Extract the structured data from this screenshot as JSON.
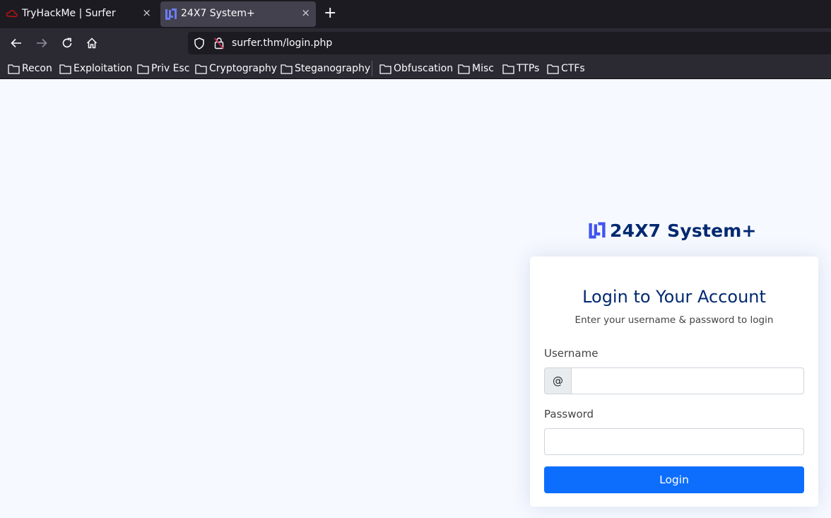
{
  "browser": {
    "tabs": [
      {
        "title": "TryHackMe | Surfer",
        "active": false,
        "favicon": "tryhackme-cloud-icon"
      },
      {
        "title": "24X7 System+",
        "active": true,
        "favicon": "system-logo-icon"
      }
    ],
    "new_tab_label": "+",
    "close_glyph": "×",
    "url": "surfer.thm/login.php",
    "bookmarks": [
      "Recon",
      "Exploitation",
      "Priv Esc",
      "Cryptography",
      "Steganography",
      "Obfuscation",
      "Misc",
      "TTPs",
      "CTFs"
    ]
  },
  "page": {
    "brand": "24X7 System+",
    "brand_color": "#012970",
    "logo_color": "#4154f1",
    "login": {
      "title": "Login to Your Account",
      "subtitle": "Enter your username & password to login",
      "username_label": "Username",
      "username_prefix": "@",
      "username_value": "",
      "password_label": "Password",
      "password_value": "",
      "button_label": "Login",
      "button_color": "#0d6efd"
    }
  }
}
